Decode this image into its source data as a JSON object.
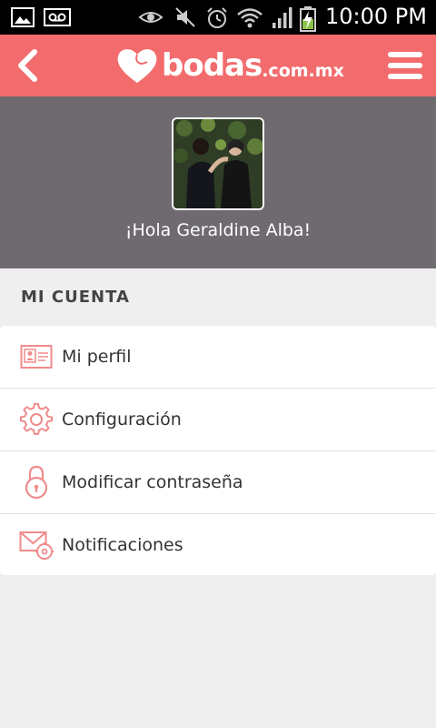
{
  "status_bar": {
    "time": "10:00 PM",
    "icons": [
      "image-icon",
      "voicemail-icon",
      "eye-icon",
      "mute-icon",
      "alarm-icon",
      "wifi-icon",
      "signal-icon",
      "battery-charging-icon"
    ]
  },
  "app_bar": {
    "logo_word": "bodas",
    "logo_tld": ".com.mx",
    "back_icon": "back-arrow-icon",
    "menu_icon": "hamburger-menu-icon"
  },
  "profile": {
    "greeting": "¡Hola Geraldine Alba!"
  },
  "account": {
    "section_title": "MI CUENTA",
    "items": [
      {
        "label": "Mi perfil",
        "icon": "profile-card-icon"
      },
      {
        "label": "Configuración",
        "icon": "gear-icon"
      },
      {
        "label": "Modificar contraseña",
        "icon": "lock-icon"
      },
      {
        "label": "Notificaciones",
        "icon": "envelope-settings-icon"
      }
    ]
  },
  "colors": {
    "accent": "#f26c6e",
    "header_bg": "#6e6a70",
    "page_bg": "#efefef",
    "icon_color": "#f08b8b"
  }
}
